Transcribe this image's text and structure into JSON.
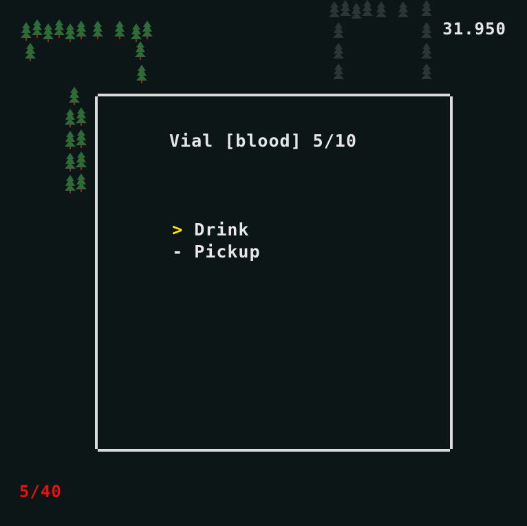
{
  "hud": {
    "timer": "31.950",
    "health": "5/40"
  },
  "dialog": {
    "title": "Vial [blood] 5/10",
    "options": [
      {
        "marker": ">",
        "label": "Drink",
        "selected": true
      },
      {
        "marker": "-",
        "label": "Pickup",
        "selected": false
      }
    ]
  },
  "colors": {
    "background": "#0c1617",
    "border": "#dcdcdc",
    "text": "#e6e6e6",
    "selected_marker": "#ffea00",
    "health": "#e8110e",
    "tree_green": "#2f6b37",
    "tree_trunk": "#b31818",
    "tree_dim": "#2c3535"
  },
  "icons": {
    "tree": "pine-tree-icon",
    "dim_tree": "faded-pine-tree-icon"
  }
}
